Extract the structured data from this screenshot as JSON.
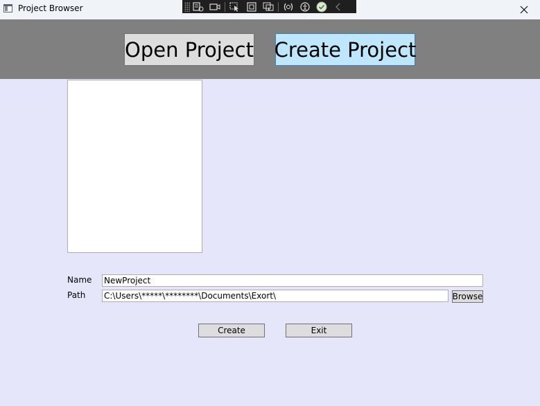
{
  "window": {
    "title": "Project Browser"
  },
  "header": {
    "open_project_label": "Open Project",
    "create_project_label": "Create Project",
    "active_tab": "create_project"
  },
  "form": {
    "name_label": "Name",
    "name_value": "NewProject",
    "path_label": "Path",
    "path_value": "C:\\Users\\*****\\********\\Documents\\Exort\\",
    "browse_label": "Browse",
    "create_label": "Create",
    "exit_label": "Exit"
  },
  "colors": {
    "background": "#e6e6fa",
    "header": "#808080",
    "active_button": "#bee6fd",
    "button": "#dddddd"
  }
}
